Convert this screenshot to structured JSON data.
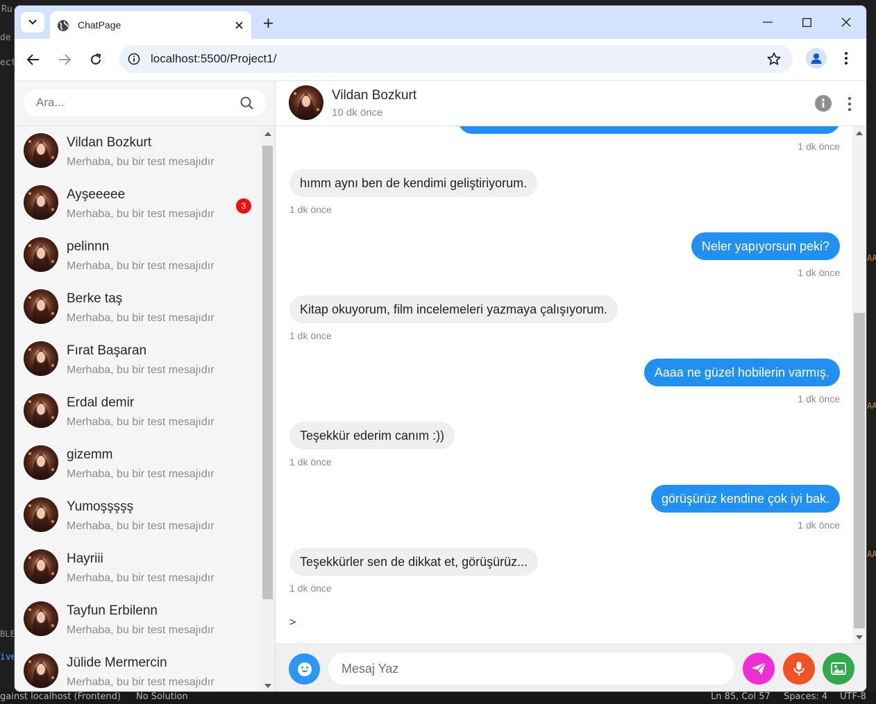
{
  "browser": {
    "tab_title": "ChatPage",
    "url": "localhost:5500/Project1/"
  },
  "background_editor": {
    "fragments": [
      "Ru",
      "de",
      "ect",
      "BLE",
      "ive",
      "AA",
      "AA",
      "AA"
    ],
    "status_left": "gainst localhost (Frontend)",
    "status_solution": "No Solution",
    "status_position": "Ln 85, Col 57",
    "status_spaces": "Spaces: 4",
    "status_encoding": "UTF-8"
  },
  "sidebar": {
    "search_placeholder": "Ara...",
    "contacts": [
      {
        "name": "Vildan Bozkurt",
        "preview": "Merhaba, bu bir test mesajıdır"
      },
      {
        "name": "Ayşeeeee",
        "preview": "Merhaba, bu bir test mesajıdır",
        "unread": "3"
      },
      {
        "name": "pelinnn",
        "preview": "Merhaba, bu bir test mesajıdır"
      },
      {
        "name": "Berke taş",
        "preview": "Merhaba, bu bir test mesajıdır"
      },
      {
        "name": "Fırat Başaran",
        "preview": "Merhaba, bu bir test mesajıdır"
      },
      {
        "name": "Erdal demir",
        "preview": "Merhaba, bu bir test mesajıdır"
      },
      {
        "name": "gizemm",
        "preview": "Merhaba, bu bir test mesajıdır"
      },
      {
        "name": "Yumoşşşşş",
        "preview": "Merhaba, bu bir test mesajıdır"
      },
      {
        "name": "Hayriii",
        "preview": "Merhaba, bu bir test mesajıdır"
      },
      {
        "name": "Tayfun Erbilenn",
        "preview": "Merhaba, bu bir test mesajıdır"
      },
      {
        "name": "Jülide Mermercin",
        "preview": "Merhaba, bu bir test mesajıdır"
      }
    ]
  },
  "chat": {
    "contact_name": "Vildan Bozkurt",
    "contact_status": "10 dk önce",
    "messages": [
      {
        "dir": "out",
        "text": "",
        "time": "1 dk önce"
      },
      {
        "dir": "in",
        "text": "hımm aynı ben de kendimi geliştiriyorum.",
        "time": "1 dk önce"
      },
      {
        "dir": "out",
        "text": "Neler yapıyorsun peki?",
        "time": "1 dk önce"
      },
      {
        "dir": "in",
        "text": "Kitap okuyorum, film incelemeleri yazmaya çalışıyorum.",
        "time": "1 dk önce"
      },
      {
        "dir": "out",
        "text": "Aaaa ne güzel hobilerin varmış.",
        "time": "1 dk önce"
      },
      {
        "dir": "in",
        "text": "Teşekkür ederim canım :))",
        "time": "1 dk önce"
      },
      {
        "dir": "out",
        "text": "görüşürüz kendine çok iyi bak.",
        "time": "1 dk önce"
      },
      {
        "dir": "in",
        "text": "Teşekkürler sen de dikkat et, görüşürüz...",
        "time": "1 dk önce"
      }
    ],
    "stray_text": ">",
    "composer_placeholder": "Mesaj Yaz"
  },
  "colors": {
    "outgoing_bubble": "#2290f0",
    "incoming_bubble": "#efefef",
    "send_button": "#ef2fd5",
    "mic_button": "#f25325",
    "image_button": "#31a94c",
    "emoji_button": "#2b96f3",
    "unread_badge": "#e11111"
  }
}
